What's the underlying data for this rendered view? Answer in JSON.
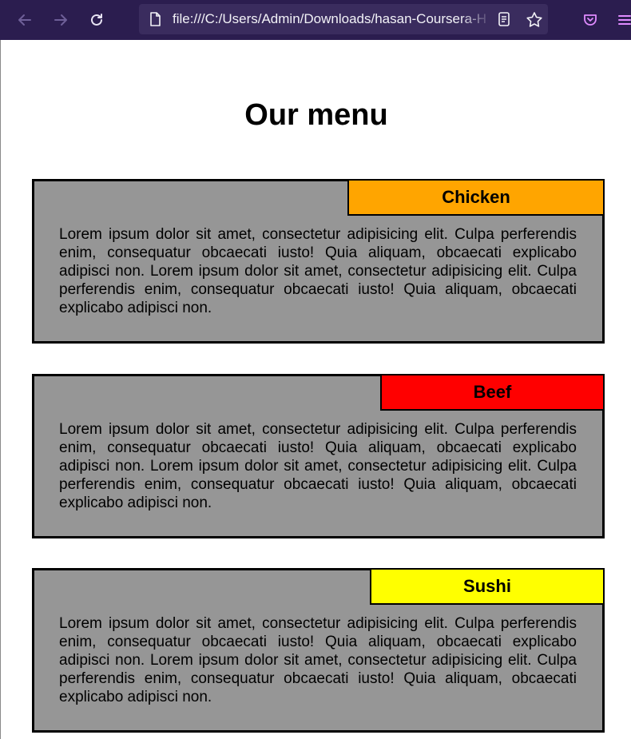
{
  "browser": {
    "url": "file:///C:/Users/Admin/Downloads/hasan-Coursera-H",
    "icons": [
      "back-arrow-icon",
      "forward-arrow-icon",
      "reload-icon",
      "page-icon",
      "reader-view-icon",
      "bookmark-star-icon",
      "pocket-icon",
      "menu-icon"
    ]
  },
  "page": {
    "title": "Our menu",
    "items": [
      {
        "label": "Chicken",
        "color": "#ffa500",
        "text": "Lorem ipsum dolor sit amet, consectetur adipisicing elit. Culpa perferendis enim, consequatur obcaecati iusto! Quia aliquam, obcaecati explicabo adipisci non. Lorem ipsum dolor sit amet, consectetur adipisicing elit. Culpa perferendis enim, consequatur obcaecati iusto! Quia aliquam, obcaecati explicabo adipisci non."
      },
      {
        "label": "Beef",
        "color": "#ff0000",
        "text": "Lorem ipsum dolor sit amet, consectetur adipisicing elit. Culpa perferendis enim, consequatur obcaecati iusto! Quia aliquam, obcaecati explicabo adipisci non. Lorem ipsum dolor sit amet, consectetur adipisicing elit. Culpa perferendis enim, consequatur obcaecati iusto! Quia aliquam, obcaecati explicabo adipisci non."
      },
      {
        "label": "Sushi",
        "color": "#ffff00",
        "text": "Lorem ipsum dolor sit amet, consectetur adipisicing elit. Culpa perferendis enim, consequatur obcaecati iusto! Quia aliquam, obcaecati explicabo adipisci non. Lorem ipsum dolor sit amet, consectetur adipisicing elit. Culpa perferendis enim, consequatur obcaecati iusto! Quia aliquam, obcaecati explicabo adipisci non."
      }
    ]
  }
}
